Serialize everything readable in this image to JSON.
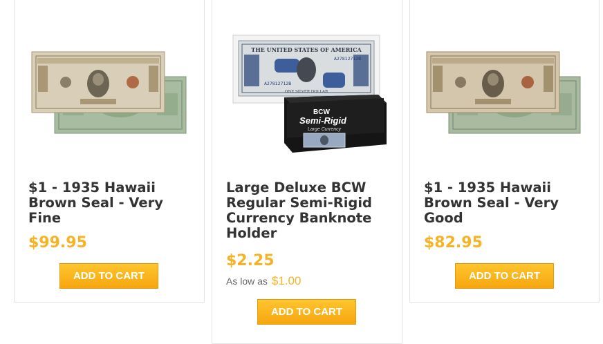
{
  "products": [
    {
      "title": "$1 - 1935 Hawaii Brown Seal - Very Fine",
      "price": "$99.95",
      "button": "ADD TO CART",
      "image": "banknote-pair-image"
    },
    {
      "title": "Large Deluxe BCW Regular Semi-Rigid Currency Banknote Holder",
      "price": "$2.25",
      "as_low_as_label": "As low as",
      "as_low_as_price": "$1.00",
      "button": "ADD TO CART",
      "image": "banknote-holder-image",
      "image_text": {
        "note_header": "THE UNITED STATES OF AMERICA",
        "serial": "A27812712B",
        "note_footer": "ONE SILVER DOLLAR",
        "box_brand": "BCW",
        "box_line1": "Semi-Rigid",
        "box_line2": "Large Currency"
      }
    },
    {
      "title": "$1 - 1935 Hawaii Brown Seal - Very Good",
      "price": "$82.95",
      "button": "ADD TO CART",
      "image": "banknote-pair-image"
    }
  ],
  "colors": {
    "accent_price": "#f5b325",
    "button_top": "#ffc52e",
    "button_bottom": "#f6a60f",
    "note_brown": "#b7a17a",
    "note_green": "#9fb49a",
    "border": "#e3e3e3"
  }
}
